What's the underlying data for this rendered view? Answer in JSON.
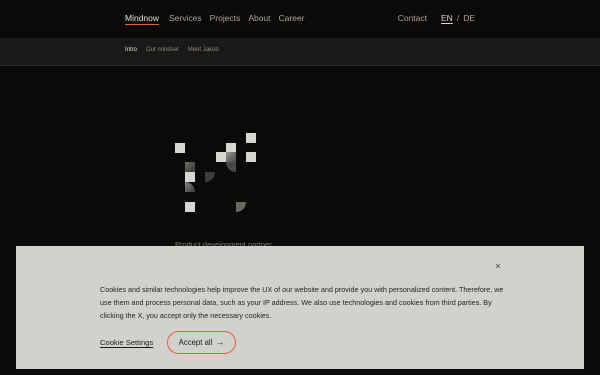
{
  "nav": {
    "brand": "Mindnow",
    "links": [
      "Services",
      "Projects",
      "About",
      "Career"
    ],
    "contact": "Contact",
    "lang_active": "EN",
    "lang_sep": "/",
    "lang_other": "DE"
  },
  "subnav": {
    "items": [
      "Intro",
      "Our mindset",
      "Meet Jakob"
    ]
  },
  "hero": {
    "tagline": "Product development partner"
  },
  "cookie": {
    "text": "Cookies and similar technologies help improve the UX of our website and provide you with personalized content. Therefore, we use them and process personal data, such as your IP address. We also use technologies and cookies from third parties. By clicking the X, you accept only the necessary cookies.",
    "settings_label": "Cookie Settings",
    "accept_label": "Accept all",
    "close_glyph": "×",
    "accent_color": "#e0623d"
  }
}
